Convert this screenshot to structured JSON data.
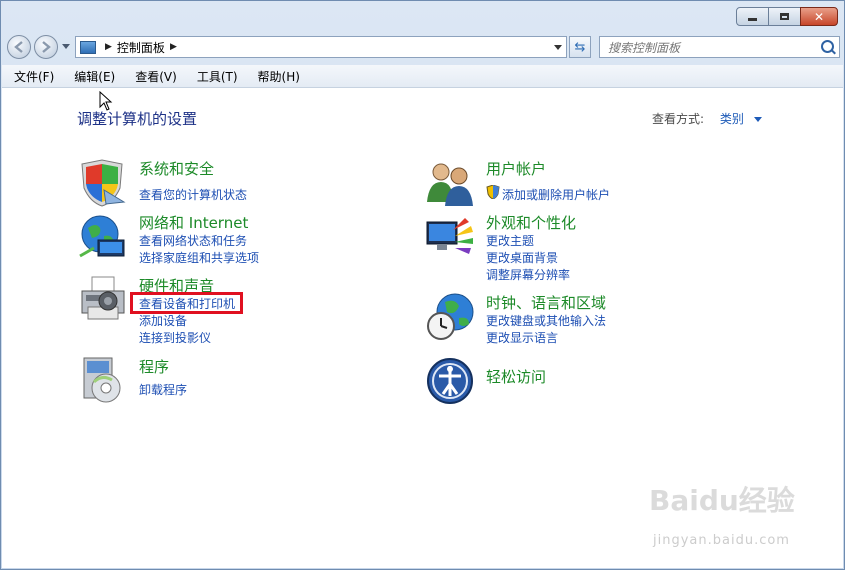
{
  "window": {
    "controls": {
      "minimize": "▭",
      "maximize": "▢",
      "close": "✕"
    }
  },
  "navbar": {
    "breadcrumb": [
      "控制面板"
    ],
    "search_placeholder": "搜索控制面板"
  },
  "menubar": [
    "文件(F)",
    "编辑(E)",
    "查看(V)",
    "工具(T)",
    "帮助(H)"
  ],
  "content": {
    "title": "调整计算机的设置",
    "view_by_label": "查看方式:",
    "view_by_value": "类别",
    "categories": [
      {
        "title": "系统和安全",
        "links": [
          "查看您的计算机状态"
        ],
        "icon": "shield-icon"
      },
      {
        "title": "网络和 Internet",
        "links": [
          "查看网络状态和任务",
          "选择家庭组和共享选项"
        ],
        "icon": "network-globe-icon"
      },
      {
        "title": "硬件和声音",
        "links": [
          "查看设备和打印机",
          "添加设备",
          "连接到投影仪"
        ],
        "icon": "printer-icon"
      },
      {
        "title": "程序",
        "links": [
          "卸载程序"
        ],
        "icon": "programs-disc-icon"
      },
      {
        "title": "用户帐户",
        "links": [
          "添加或删除用户帐户"
        ],
        "icon": "users-icon"
      },
      {
        "title": "外观和个性化",
        "links": [
          "更改主题",
          "更改桌面背景",
          "调整屏幕分辨率"
        ],
        "icon": "display-palette-icon"
      },
      {
        "title": "时钟、语言和区域",
        "links": [
          "更改键盘或其他输入法",
          "更改显示语言"
        ],
        "icon": "clock-globe-icon"
      },
      {
        "title": "轻松访问",
        "links": [],
        "icon": "accessibility-icon"
      }
    ]
  },
  "watermark": {
    "brand": "Baidu经验",
    "url": "jingyan.baidu.com"
  },
  "colors": {
    "category_title": "#1c8a28",
    "link": "#1e4fb3",
    "page_title": "#1e3287",
    "highlight": "#e01020"
  }
}
